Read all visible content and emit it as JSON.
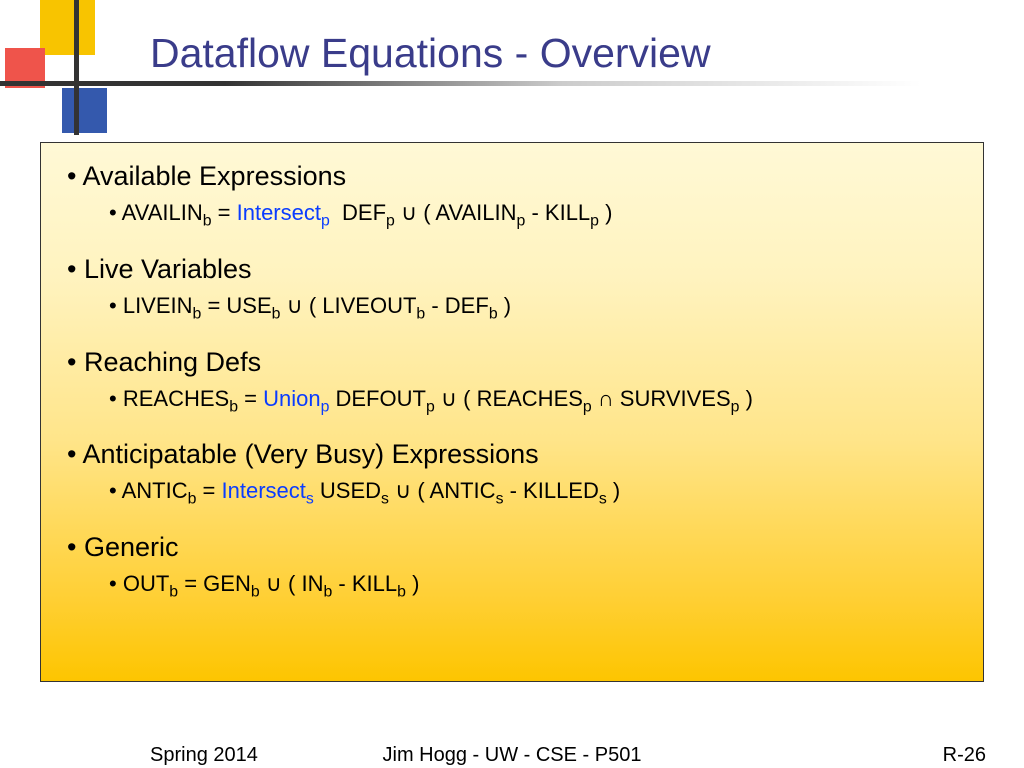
{
  "title": "Dataflow Equations - Overview",
  "items": [
    {
      "heading": "Available Expressions",
      "eq": {
        "lhs": "AVAILIN",
        "lhs_sub": "b",
        "op": "Intersect",
        "op_sub": "p",
        "parts": [
          "DEF",
          "p",
          "∪",
          "( AVAILIN",
          "p",
          "- KILL",
          "p",
          ")"
        ]
      }
    },
    {
      "heading": "Live Variables",
      "eq": {
        "lhs": "LIVEIN",
        "lhs_sub": "b",
        "op": "",
        "op_sub": "",
        "parts": [
          "USE",
          "b",
          "∪",
          "( LIVEOUT",
          "b",
          "- DEF",
          "b",
          ")"
        ]
      }
    },
    {
      "heading": "Reaching Defs",
      "eq": {
        "lhs": "REACHES",
        "lhs_sub": "b",
        "op": "Union",
        "op_sub": "p",
        "parts": [
          "DEFOUT",
          "p",
          "∪",
          "( REACHES",
          "p",
          "∩ SURVIVES",
          "p",
          ")"
        ]
      }
    },
    {
      "heading": "Anticipatable (Very Busy) Expressions",
      "eq": {
        "lhs": "ANTIC",
        "lhs_sub": "b",
        "op": "Intersect",
        "op_sub": "s",
        "parts": [
          "USED",
          "s",
          "∪",
          "( ANTIC",
          "s",
          "- KILLED",
          "s",
          ")"
        ]
      }
    },
    {
      "heading": "Generic",
      "eq": {
        "lhs": "OUT",
        "lhs_sub": "b",
        "op": "",
        "op_sub": "",
        "parts": [
          "GEN",
          "b",
          "∪",
          "( IN",
          "b",
          "- KILL",
          "b",
          ")"
        ]
      }
    }
  ],
  "footer": {
    "left": "Spring 2014",
    "center": "Jim Hogg - UW - CSE - P501",
    "right": "R-26"
  }
}
